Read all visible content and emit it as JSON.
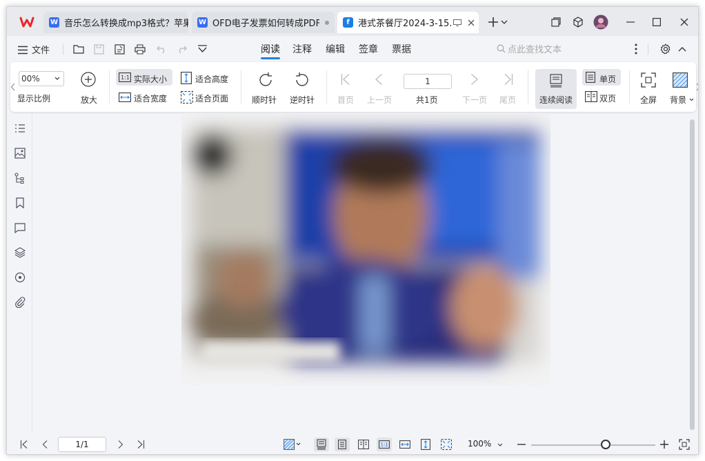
{
  "tabs": [
    {
      "title": "音乐怎么转换成mp3格式？苹果",
      "icon": "W",
      "icon_color": "#3a6df0"
    },
    {
      "title": "OFD电子发票如何转成PDF？",
      "icon": "W",
      "icon_color": "#3a6df0"
    },
    {
      "title": "港式茶餐厅2024-3-15.o",
      "icon": "f",
      "icon_color": "#1c7ee8"
    }
  ],
  "menu": {
    "file": "文件",
    "tabs": [
      "阅读",
      "注释",
      "编辑",
      "签章",
      "票据"
    ],
    "search_placeholder": "点此查找文本"
  },
  "ribbon": {
    "zoom_value": "00%",
    "zoom_label": "显示比例",
    "zoom_in": "放大",
    "actual_size": "实际大小",
    "fit_width": "适合宽度",
    "fit_height": "适合高度",
    "fit_page": "适合页面",
    "rotate_cw": "顺时针",
    "rotate_ccw": "逆时针",
    "first_page": "首页",
    "prev_page": "上一页",
    "page_input": "1",
    "total_pages": "共1页",
    "next_page": "下一页",
    "last_page": "尾页",
    "continuous": "连续阅读",
    "single_page": "单页",
    "double_page": "双页",
    "fullscreen": "全屏",
    "background": "背景"
  },
  "statusbar": {
    "page_indicator": "1/1",
    "zoom": "100%",
    "zoom_level": 0.6
  },
  "colors": {
    "accent": "#2a7de1",
    "wps_red": "#e8262b"
  }
}
